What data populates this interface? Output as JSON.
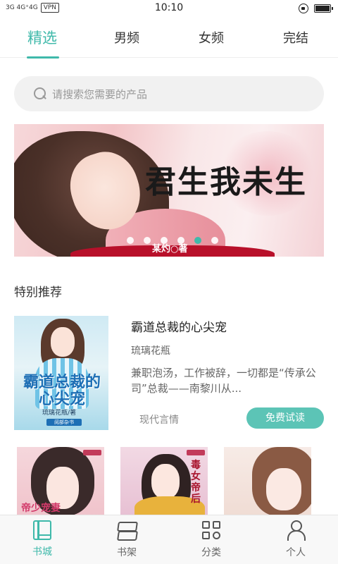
{
  "status_bar": {
    "signal_text": "3G 4G⁺4G",
    "vpn": "VPN",
    "time": "10:10"
  },
  "tabs": [
    {
      "label": "精选",
      "active": true
    },
    {
      "label": "男频",
      "active": false
    },
    {
      "label": "女频",
      "active": false
    },
    {
      "label": "完结",
      "active": false
    }
  ],
  "search": {
    "placeholder": "请搜索您需要的产品",
    "icon": "search-icon"
  },
  "banner": {
    "title": "君生我未生",
    "author": "某灼○著",
    "dots_count": 6,
    "active_dot_index": 4
  },
  "section": {
    "title": "特别推荐"
  },
  "featured_book": {
    "cover_title": "霸道总裁的心尖宠",
    "cover_author": "琉璃花瓶/著",
    "cover_publisher": "阅部杂书",
    "title": "霸道总裁的心尖宠",
    "author": "琉璃花瓶",
    "description": "兼职泡汤，工作被辞，一切都是“传承公司”总裁——南黎川从...",
    "tag": "现代言情",
    "button_label": "免费试读"
  },
  "more_books": [
    {
      "cover_text": "帝少宠妻"
    },
    {
      "cover_text": "毒女帝后"
    },
    {
      "cover_text": ""
    }
  ],
  "bottom_nav": [
    {
      "label": "书城",
      "icon": "bookstore-icon",
      "active": true
    },
    {
      "label": "书架",
      "icon": "bookshelf-icon",
      "active": false
    },
    {
      "label": "分类",
      "icon": "category-icon",
      "active": false
    },
    {
      "label": "个人",
      "icon": "user-icon",
      "active": false
    }
  ],
  "colors": {
    "accent": "#3fb9aa",
    "button": "#5cc4b6"
  }
}
